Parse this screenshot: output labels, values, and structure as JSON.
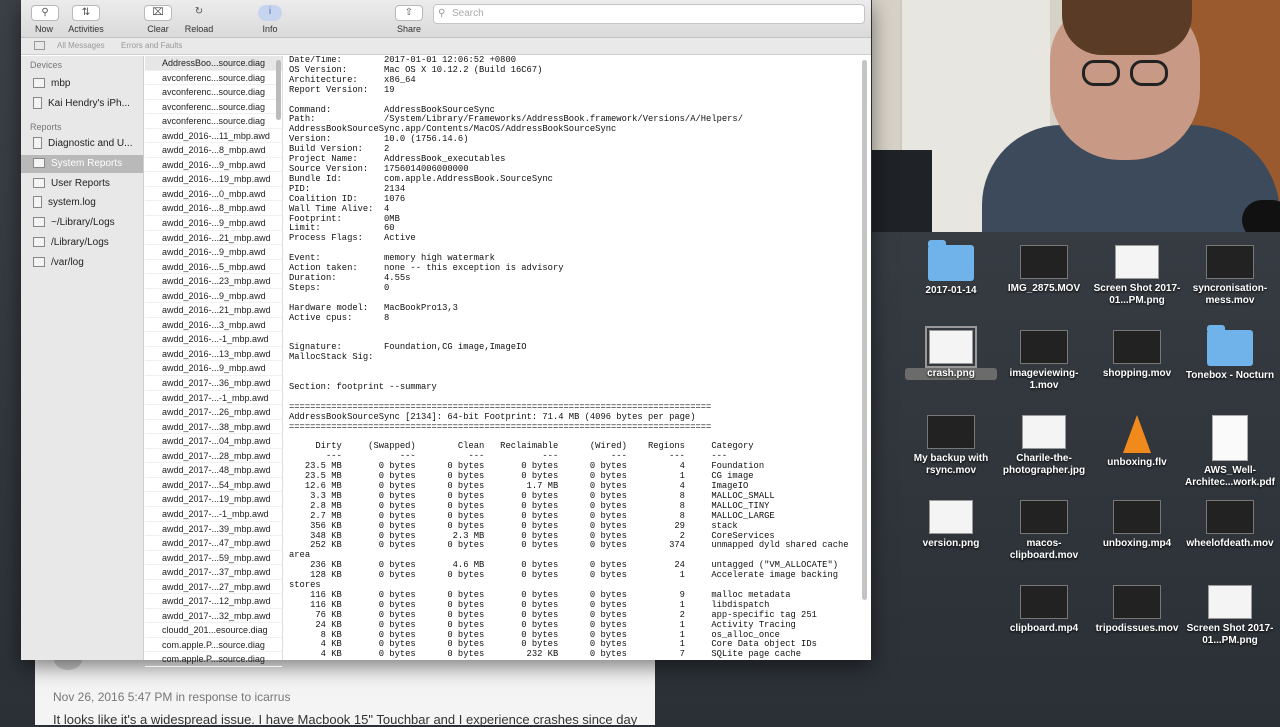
{
  "toolbar": {
    "now": "Now",
    "activities": "Activities",
    "clear": "Clear",
    "reload": "Reload",
    "info": "Info",
    "share": "Share",
    "search_placeholder": "Search"
  },
  "filterbar": {
    "all": "All Messages",
    "errors": "Errors and Faults"
  },
  "sidebar": {
    "devices_header": "Devices",
    "reports_header": "Reports",
    "devices": [
      "mbp",
      "Kai Hendry's iPh..."
    ],
    "reports": [
      "Diagnostic and U...",
      "System Reports",
      "User Reports",
      "system.log",
      "~/Library/Logs",
      "/Library/Logs",
      "/var/log"
    ]
  },
  "files": [
    "AddressBoo...source.diag",
    "avconferenc...source.diag",
    "avconferenc...source.diag",
    "avconferenc...source.diag",
    "avconferenc...source.diag",
    "awdd_2016-...11_mbp.awd",
    "awdd_2016-...8_mbp.awd",
    "awdd_2016-...9_mbp.awd",
    "awdd_2016-...19_mbp.awd",
    "awdd_2016-...0_mbp.awd",
    "awdd_2016-...8_mbp.awd",
    "awdd_2016-...9_mbp.awd",
    "awdd_2016-...21_mbp.awd",
    "awdd_2016-...9_mbp.awd",
    "awdd_2016-...5_mbp.awd",
    "awdd_2016-...23_mbp.awd",
    "awdd_2016-...9_mbp.awd",
    "awdd_2016-...21_mbp.awd",
    "awdd_2016-...3_mbp.awd",
    "awdd_2016-...-1_mbp.awd",
    "awdd_2016-...13_mbp.awd",
    "awdd_2016-...9_mbp.awd",
    "awdd_2017-...36_mbp.awd",
    "awdd_2017-...-1_mbp.awd",
    "awdd_2017-...26_mbp.awd",
    "awdd_2017-...38_mbp.awd",
    "awdd_2017-...04_mbp.awd",
    "awdd_2017-...28_mbp.awd",
    "awdd_2017-...48_mbp.awd",
    "awdd_2017-...54_mbp.awd",
    "awdd_2017-...19_mbp.awd",
    "awdd_2017-...-1_mbp.awd",
    "awdd_2017-...39_mbp.awd",
    "awdd_2017-...47_mbp.awd",
    "awdd_2017-...59_mbp.awd",
    "awdd_2017-...37_mbp.awd",
    "awdd_2017-...27_mbp.awd",
    "awdd_2017-...12_mbp.awd",
    "awdd_2017-...32_mbp.awd",
    "cloudd_201...esource.diag",
    "com.apple.P...source.diag",
    "com.apple.P...source.diag"
  ],
  "log_text": "Date/Time:        2017-01-01 12:06:52 +0800\nOS Version:       Mac OS X 10.12.2 (Build 16C67)\nArchitecture:     x86_64\nReport Version:   19\n\nCommand:          AddressBookSourceSync\nPath:             /System/Library/Frameworks/AddressBook.framework/Versions/A/Helpers/\nAddressBookSourceSync.app/Contents/MacOS/AddressBookSourceSync\nVersion:          10.0 (1756.14.6)\nBuild Version:    2\nProject Name:     AddressBook_executables\nSource Version:   1756014006000000\nBundle Id:        com.apple.AddressBook.SourceSync\nPID:              2134\nCoalition ID:     1076\nWall Time Alive:  4\nFootprint:        0MB\nLimit:            60\nProcess Flags:    Active\n\nEvent:            memory high watermark\nAction taken:     none -- this exception is advisory\nDuration:         4.55s\nSteps:            0\n\nHardware model:   MacBookPro13,3\nActive cpus:      8\n\n\nSignature:        Foundation,CG image,ImageIO\nMallocStack Sig:\n\n\nSection: footprint --summary\n\n================================================================================\nAddressBookSourceSync [2134]: 64-bit Footprint: 71.4 MB (4096 bytes per page)\n================================================================================\n\n     Dirty     (Swapped)        Clean   Reclaimable      (Wired)    Regions     Category\n       ---           ---          ---           ---          ---        ---     ---\n   23.5 MB       0 bytes      0 bytes       0 bytes      0 bytes          4     Foundation\n   23.5 MB       0 bytes      0 bytes       0 bytes      0 bytes          1     CG image\n   12.6 MB       0 bytes      0 bytes        1.7 MB      0 bytes          4     ImageIO\n    3.3 MB       0 bytes      0 bytes       0 bytes      0 bytes          8     MALLOC_SMALL\n    2.8 MB       0 bytes      0 bytes       0 bytes      0 bytes          8     MALLOC_TINY\n    2.7 MB       0 bytes      0 bytes       0 bytes      0 bytes          8     MALLOC_LARGE\n    356 KB       0 bytes      0 bytes       0 bytes      0 bytes         29     stack\n    348 KB       0 bytes       2.3 MB       0 bytes      0 bytes          2     CoreServices\n    252 KB       0 bytes      0 bytes       0 bytes      0 bytes        374     unmapped dyld shared cache\narea\n    236 KB       0 bytes       4.6 MB       0 bytes      0 bytes         24     untagged (\"VM_ALLOCATE\")\n    128 KB       0 bytes      0 bytes       0 bytes      0 bytes          1     Accelerate image backing\nstores\n    116 KB       0 bytes      0 bytes       0 bytes      0 bytes          9     malloc metadata\n    116 KB       0 bytes      0 bytes       0 bytes      0 bytes          1     libdispatch\n     76 KB       0 bytes      0 bytes       0 bytes      0 bytes          2     app-specific tag 251\n     24 KB       0 bytes      0 bytes       0 bytes      0 bytes          1     Activity Tracing\n      8 KB       0 bytes      0 bytes       0 bytes      0 bytes          1     os_alloc_once\n      4 KB       0 bytes      0 bytes       0 bytes      0 bytes          1     Core Data object IDs\n      4 KB       0 bytes      0 bytes        232 KB      0 bytes          7     SQLite page cache",
  "desktop": [
    {
      "label": "2017-01-14",
      "kind": "folder"
    },
    {
      "label": "IMG_2875.MOV",
      "kind": "vid"
    },
    {
      "label": "Screen Shot 2017-01...PM.png",
      "kind": "png"
    },
    {
      "label": "syncronisation-mess.mov",
      "kind": "vid"
    },
    {
      "label": "crash.png",
      "kind": "png",
      "selected": true
    },
    {
      "label": "imageviewing-1.mov",
      "kind": "vid"
    },
    {
      "label": "shopping.mov",
      "kind": "vid"
    },
    {
      "label": "Tonebox - Nocturn",
      "kind": "folder"
    },
    {
      "label": "My backup with rsync.mov",
      "kind": "vid"
    },
    {
      "label": "Charile-the-photographer.jpg",
      "kind": "png"
    },
    {
      "label": "unboxing.flv",
      "kind": "cone"
    },
    {
      "label": "AWS_Well-Architec...work.pdf",
      "kind": "doc"
    },
    {
      "label": "version.png",
      "kind": "png"
    },
    {
      "label": "macos-clipboard.mov",
      "kind": "vid"
    },
    {
      "label": "unboxing.mp4",
      "kind": "vid"
    },
    {
      "label": "wheelofdeath.mov",
      "kind": "vid"
    },
    {
      "label": "",
      "kind": "none"
    },
    {
      "label": "clipboard.mp4",
      "kind": "vid"
    },
    {
      "label": "tripodissues.mov",
      "kind": "vid"
    },
    {
      "label": "Screen Shot 2017-01...PM.png",
      "kind": "png"
    }
  ],
  "background_window": {
    "meta": "Nov 26, 2016 5:47 PM in response to icarrus",
    "body": "It looks like it's a widespread issue.  I have Macbook 15\" Touchbar and I experience crashes since day"
  },
  "colors": {
    "folder": "#6fb3ea",
    "selection": "#b9b9b9"
  }
}
